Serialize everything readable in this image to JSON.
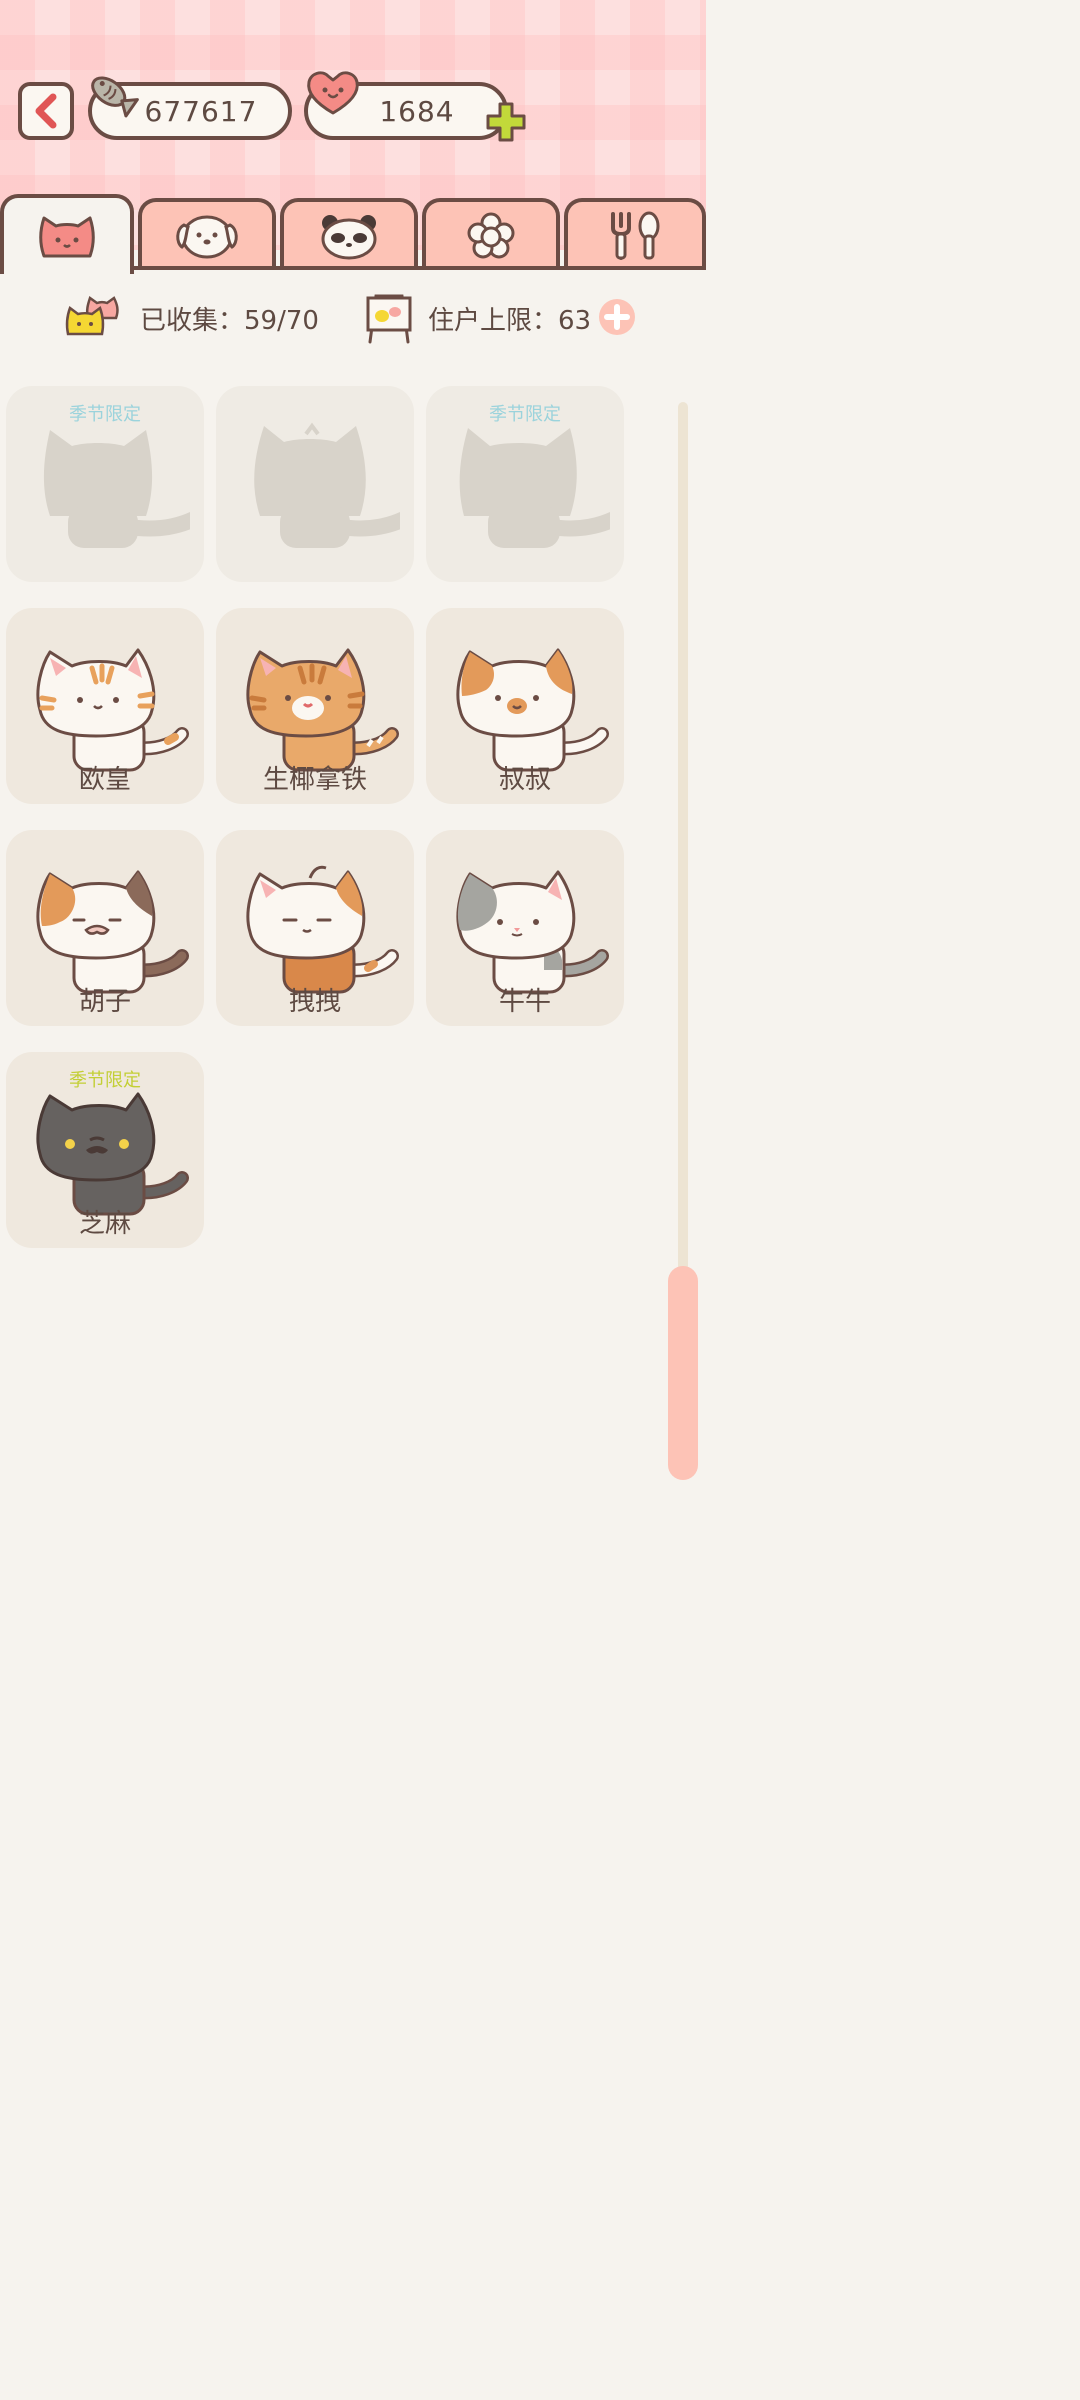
{
  "currency": {
    "fish": "677617",
    "hearts": "1684"
  },
  "tabs": [
    {
      "icon": "cat-face-icon",
      "active": true
    },
    {
      "icon": "dog-face-icon",
      "active": false
    },
    {
      "icon": "panda-face-icon",
      "active": false
    },
    {
      "icon": "flower-icon",
      "active": false
    },
    {
      "icon": "fork-spoon-icon",
      "active": false
    }
  ],
  "stats": {
    "collected": "已收集：59/70",
    "capacity": "住户上限：63"
  },
  "cats": [
    {
      "name": "",
      "season": "季节限定",
      "locked": true
    },
    {
      "name": "",
      "season": "",
      "locked": true
    },
    {
      "name": "",
      "season": "季节限定",
      "locked": true
    },
    {
      "name": "欧皇",
      "season": "",
      "locked": false
    },
    {
      "name": "生椰拿铁",
      "season": "",
      "locked": false
    },
    {
      "name": "叔叔",
      "season": "",
      "locked": false
    },
    {
      "name": "胡子",
      "season": "",
      "locked": false
    },
    {
      "name": "拽拽",
      "season": "",
      "locked": false
    },
    {
      "name": "牛牛",
      "season": "",
      "locked": false
    },
    {
      "name": "芝麻",
      "season": "季节限定",
      "locked": false
    }
  ],
  "colors": {
    "accent": "#fdc3b6",
    "outline": "#6b4c44",
    "season_blue": "#9bd3dc",
    "season_gold": "#c3cf35"
  }
}
